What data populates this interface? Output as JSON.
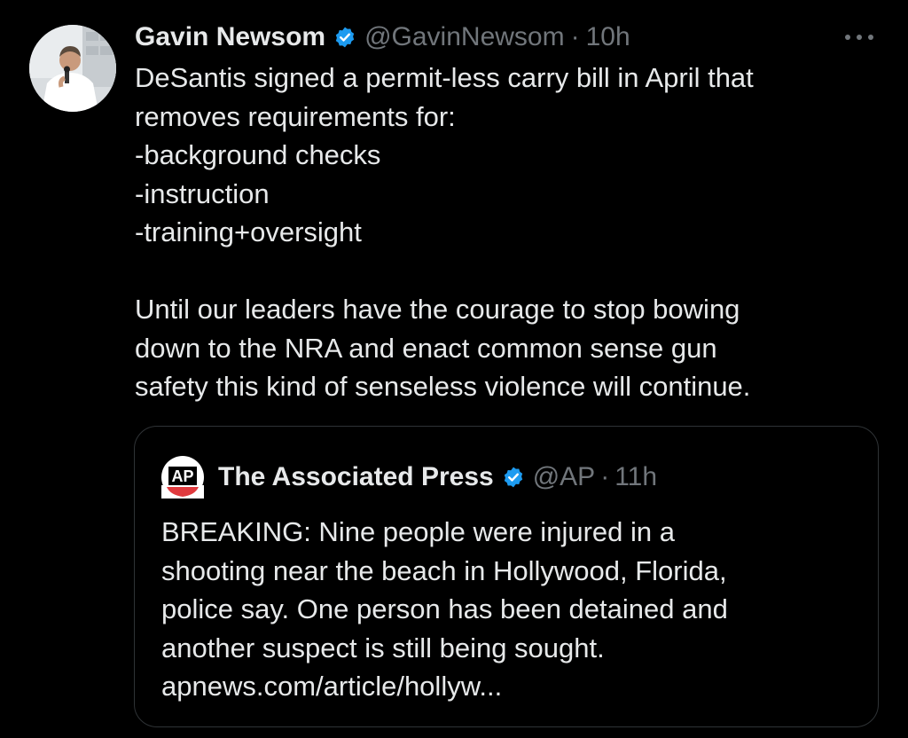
{
  "tweet": {
    "author_name": "Gavin Newsom",
    "handle": "@GavinNewsom",
    "separator": "·",
    "time": "10h",
    "verified_icon": "verified-badge-icon",
    "more_icon": "more-options-icon",
    "text_lines": [
      "DeSantis signed a permit-less carry bill in April that",
      "removes requirements for:",
      "-background checks",
      "-instruction",
      "-training+oversight",
      "",
      "Until our leaders have the courage to stop bowing",
      "down to the NRA and enact common sense gun",
      "safety this kind of senseless violence will continue."
    ]
  },
  "quoted_tweet": {
    "author_name": "The Associated Press",
    "logo_text": "AP",
    "handle": "@AP",
    "separator": "·",
    "time": "11h",
    "text_lines": [
      "BREAKING: Nine people were injured in a",
      "shooting near the beach in Hollywood, Florida,",
      "police say. One person has been detained and",
      "another suspect is still being sought.",
      "apnews.com/article/hollyw..."
    ]
  },
  "colors": {
    "background": "#000000",
    "primary_text": "#e7e9ea",
    "secondary_text": "#71767b",
    "verified_blue": "#1d9bf0",
    "border": "#2f3336"
  }
}
